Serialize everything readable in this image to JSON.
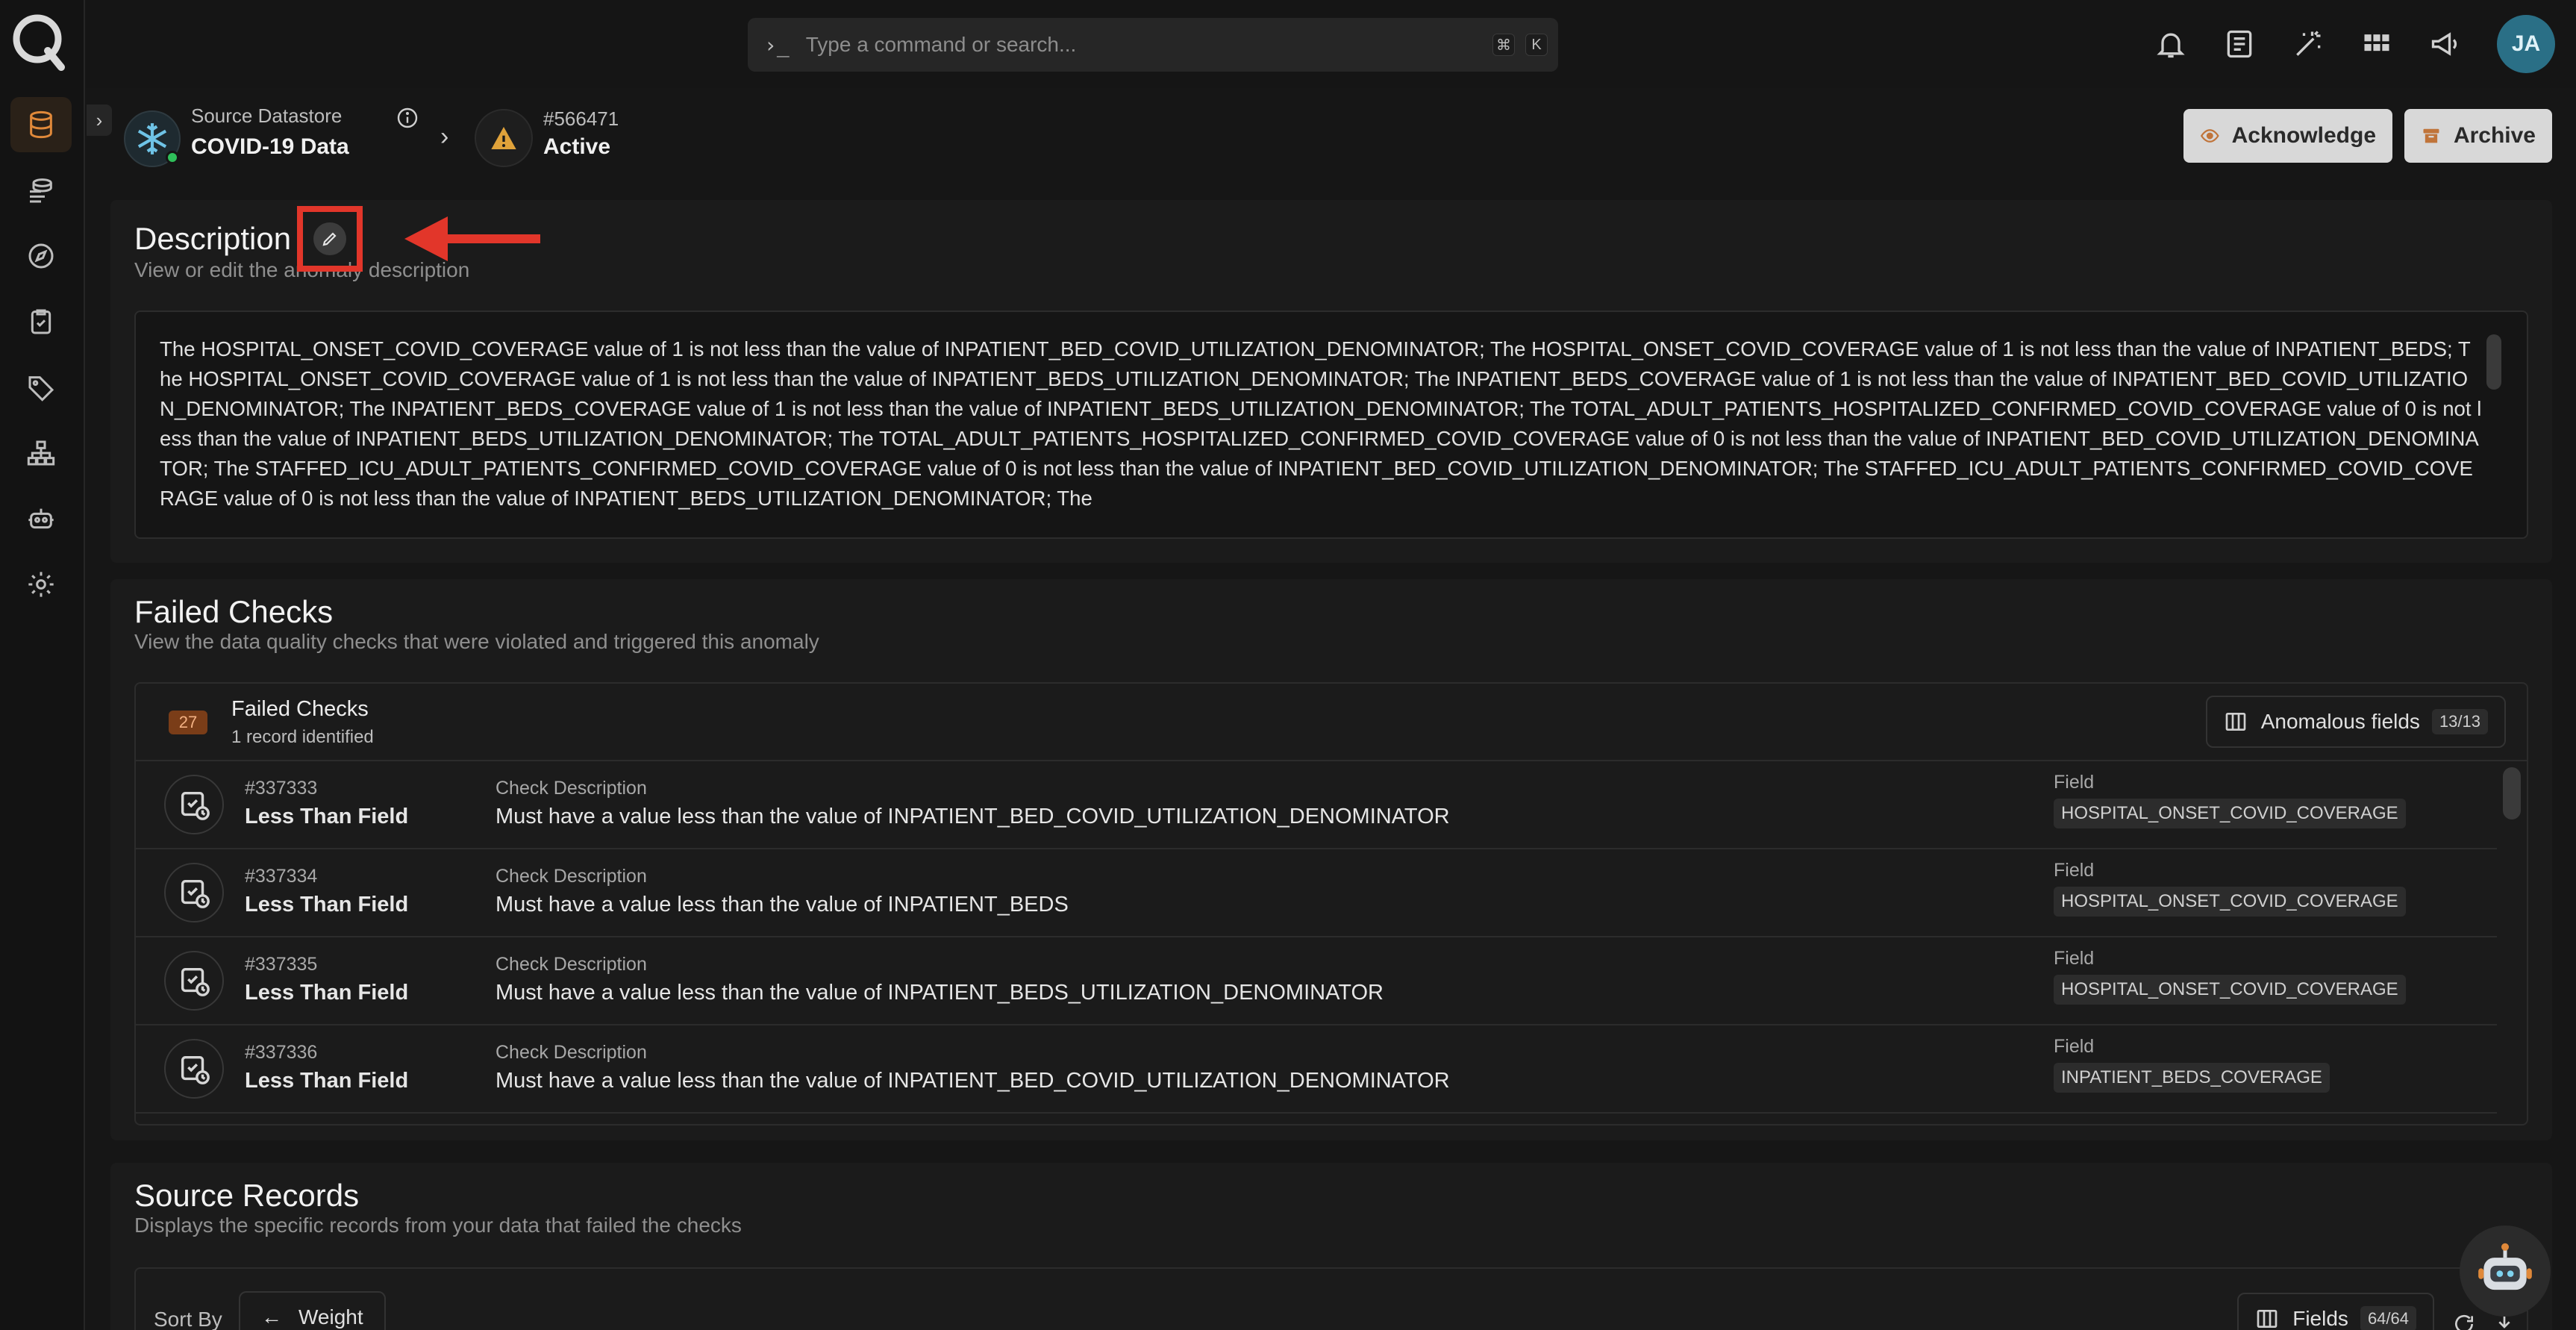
{
  "search": {
    "placeholder": "Type a command or search...",
    "prompt_glyph": "›_",
    "shortcut_keys": [
      "⌘",
      "K"
    ]
  },
  "sidebar": {
    "items": [
      {
        "name": "datastores",
        "icon": "database-icon",
        "active": true
      },
      {
        "name": "explore",
        "icon": "stack-icon"
      },
      {
        "name": "discover",
        "icon": "compass-icon"
      },
      {
        "name": "checks",
        "icon": "clipboard-check-icon"
      },
      {
        "name": "tags",
        "icon": "tag-icon"
      },
      {
        "name": "flows",
        "icon": "hierarchy-icon"
      },
      {
        "name": "agents",
        "icon": "robot-icon"
      },
      {
        "name": "settings",
        "icon": "gear-icon"
      }
    ]
  },
  "top_icons": [
    "bell-icon",
    "notes-icon",
    "wand-icon",
    "grid-icon",
    "megaphone-icon"
  ],
  "user": {
    "initials": "JA",
    "color": "#2a6f86"
  },
  "header": {
    "datastore_label": "Source Datastore",
    "datastore_name": "COVID-19 Data",
    "anomaly_id": "#566471",
    "anomaly_status": "Active",
    "acknowledge_label": "Acknowledge",
    "archive_label": "Archive"
  },
  "description": {
    "title": "Description",
    "subtitle": "View or edit the anomaly description",
    "text": "The HOSPITAL_ONSET_COVID_COVERAGE value of 1 is not less than the value of INPATIENT_BED_COVID_UTILIZATION_DENOMINATOR; The HOSPITAL_ONSET_COVID_COVERAGE value of 1 is not less than the value of INPATIENT_BEDS; The HOSPITAL_ONSET_COVID_COVERAGE value of 1 is not less than the value of INPATIENT_BEDS_UTILIZATION_DENOMINATOR; The INPATIENT_BEDS_COVERAGE value of 1 is not less than the value of INPATIENT_BED_COVID_UTILIZATION_DENOMINATOR; The INPATIENT_BEDS_COVERAGE value of 1 is not less than the value of INPATIENT_BEDS_UTILIZATION_DENOMINATOR; The TOTAL_ADULT_PATIENTS_HOSPITALIZED_CONFIRMED_COVID_COVERAGE value of 0 is not less than the value of INPATIENT_BEDS_UTILIZATION_DENOMINATOR; The TOTAL_ADULT_PATIENTS_HOSPITALIZED_CONFIRMED_COVID_COVERAGE value of 0 is not less than the value of INPATIENT_BED_COVID_UTILIZATION_DENOMINATOR; The STAFFED_ICU_ADULT_PATIENTS_CONFIRMED_COVID_COVERAGE value of 0 is not less than the value of INPATIENT_BED_COVID_UTILIZATION_DENOMINATOR; The STAFFED_ICU_ADULT_PATIENTS_CONFIRMED_COVID_COVERAGE value of 0 is not less than the value of INPATIENT_BEDS_UTILIZATION_DENOMINATOR; The"
  },
  "failed_checks": {
    "title": "Failed Checks",
    "subtitle": "View the data quality checks that were violated and triggered this anomaly",
    "panel_title": "Failed Checks",
    "count_badge": "27",
    "records_identified": "1 record identified",
    "anomalous_fields_label": "Anomalous fields",
    "anomalous_fields_count": "13/13",
    "column_description_label": "Check Description",
    "column_field_label": "Field",
    "rows": [
      {
        "id": "#337333",
        "type": "Less Than Field",
        "description": "Must have a value less than the value of INPATIENT_BED_COVID_UTILIZATION_DENOMINATOR",
        "field": "HOSPITAL_ONSET_COVID_COVERAGE"
      },
      {
        "id": "#337334",
        "type": "Less Than Field",
        "description": "Must have a value less than the value of INPATIENT_BEDS",
        "field": "HOSPITAL_ONSET_COVID_COVERAGE"
      },
      {
        "id": "#337335",
        "type": "Less Than Field",
        "description": "Must have a value less than the value of INPATIENT_BEDS_UTILIZATION_DENOMINATOR",
        "field": "HOSPITAL_ONSET_COVID_COVERAGE"
      },
      {
        "id": "#337336",
        "type": "Less Than Field",
        "description": "Must have a value less than the value of INPATIENT_BED_COVID_UTILIZATION_DENOMINATOR",
        "field": "INPATIENT_BEDS_COVERAGE"
      }
    ]
  },
  "source_records": {
    "title": "Source Records",
    "subtitle": "Displays the specific records from your data that failed the checks",
    "sort_by_label": "Sort By",
    "sort_value": "Weight",
    "fields_label": "Fields",
    "fields_count": "64/64"
  },
  "colors": {
    "accent": "#e0893a",
    "annotation_red": "#e2362a",
    "background": "#161616",
    "card": "#1b1b1b"
  }
}
